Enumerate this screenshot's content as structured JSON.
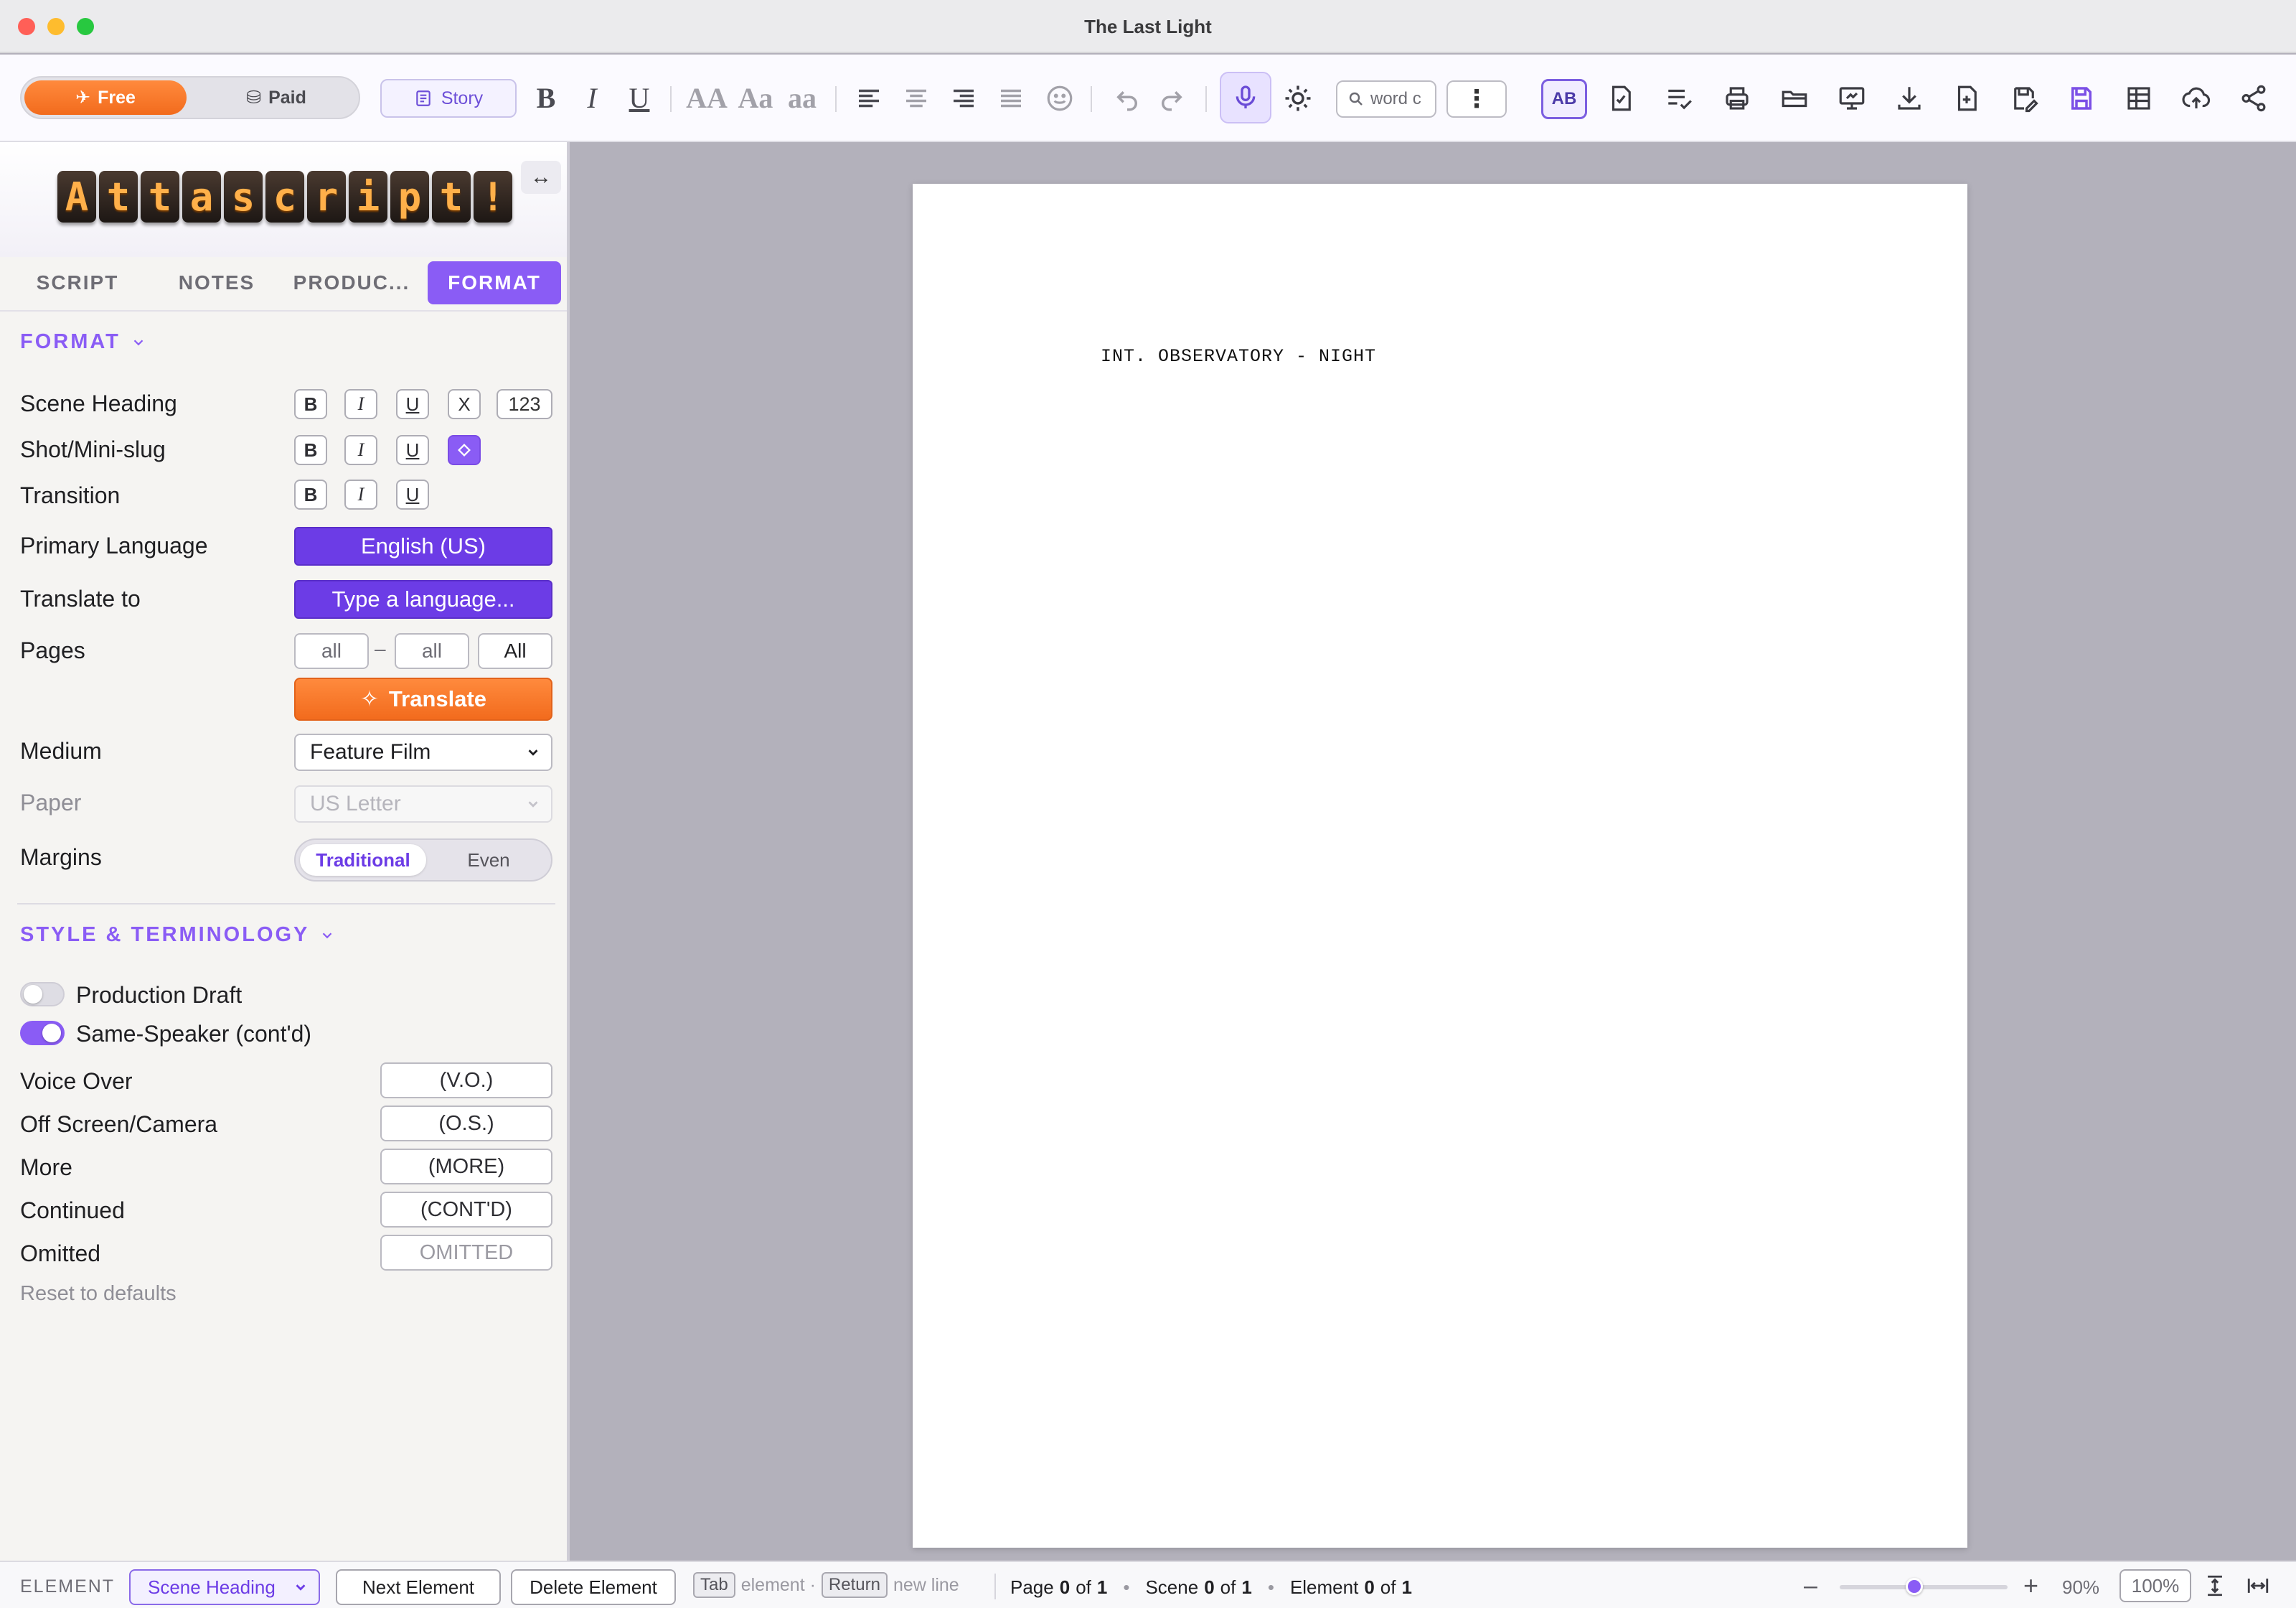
{
  "window": {
    "title": "The Last Light"
  },
  "toolbar": {
    "plan_free": "Free",
    "plan_paid": "Paid",
    "story_label": "Story",
    "case_upper": "AA",
    "case_title": "Aa",
    "case_lower": "aa",
    "search_placeholder": "word c",
    "more_label": "⋮",
    "spellcheck_label": "AB"
  },
  "sidebar": {
    "logo_letters": [
      "A",
      "t",
      "t",
      "a",
      "s",
      "c",
      "r",
      "i",
      "p",
      "t",
      "!"
    ],
    "collapse_label": "↔",
    "tabs": [
      {
        "label": "SCRIPT"
      },
      {
        "label": "NOTES"
      },
      {
        "label": "PRODUC..."
      },
      {
        "label": "FORMAT"
      }
    ],
    "format": {
      "section_title": "FORMAT",
      "scene_heading": "Scene Heading",
      "shot_mini_slug": "Shot/Mini-slug",
      "transition": "Transition",
      "bold": "B",
      "italic": "I",
      "underline": "U",
      "strike": "X",
      "number": "123",
      "primary_language_label": "Primary Language",
      "primary_language_value": "English (US)",
      "translate_to_label": "Translate to",
      "translate_to_placeholder": "Type a language...",
      "pages_label": "Pages",
      "pages_from": "all",
      "pages_dash": "–",
      "pages_to": "all",
      "pages_all_btn": "All",
      "translate_btn": "Translate",
      "medium_label": "Medium",
      "medium_value": "Feature Film",
      "paper_label": "Paper",
      "paper_value": "US Letter",
      "margins_label": "Margins",
      "margins_traditional": "Traditional",
      "margins_even": "Even"
    },
    "style": {
      "section_title": "STYLE & TERMINOLOGY",
      "production_draft": "Production Draft",
      "production_draft_on": false,
      "same_speaker": "Same-Speaker (cont'd)",
      "same_speaker_on": true,
      "voice_over_label": "Voice Over",
      "voice_over_value": "(V.O.)",
      "off_screen_label": "Off Screen/Camera",
      "off_screen_value": "(O.S.)",
      "more_label": "More",
      "more_value": "(MORE)",
      "continued_label": "Continued",
      "continued_value": "(CONT'D)",
      "omitted_label": "Omitted",
      "omitted_placeholder": "OMITTED",
      "reset_link": "Reset to defaults"
    }
  },
  "document": {
    "scene_heading": "INT. OBSERVATORY - NIGHT"
  },
  "statusbar": {
    "element_label": "ELEMENT",
    "element_select": "Scene Heading",
    "next_element": "Next Element",
    "delete_element": "Delete Element",
    "tab_key": "Tab",
    "tab_hint": "element ·",
    "return_key": "Return",
    "return_hint": "new line",
    "page_word": "Page",
    "page_current": "0",
    "page_of": "of",
    "page_total": "1",
    "scene_word": "Scene",
    "scene_current": "0",
    "scene_of": "of",
    "scene_total": "1",
    "element_word": "Element",
    "element_current": "0",
    "element_of": "of",
    "element_total": "1",
    "zoom_minus": "–",
    "zoom_plus": "+",
    "zoom_level": "90%",
    "zoom_reset": "100%"
  }
}
